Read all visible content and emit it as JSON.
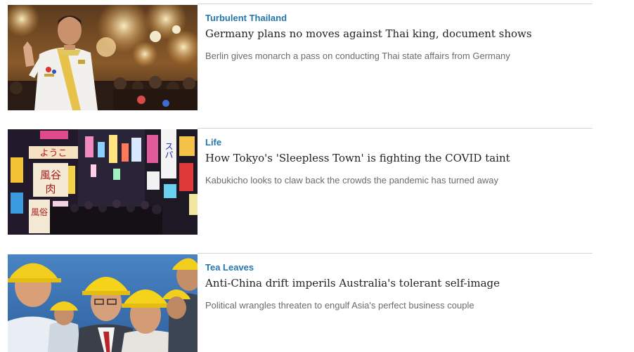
{
  "articles": [
    {
      "kicker": "Turbulent Thailand",
      "headline": "Germany plans no moves against Thai king, document shows",
      "summary": "Berlin gives monarch a pass on conducting Thai state affairs from Germany",
      "image": "photo-thai-king-waving"
    },
    {
      "kicker": "Life",
      "headline": "How Tokyo's 'Sleepless Town' is fighting the COVID taint",
      "summary": "Kabukicho looks to claw back the crowds the pandemic has turned away",
      "image": "photo-kabukicho-street-night",
      "sign_texts": [
        "ようこ",
        "風谷",
        "肉",
        "スパ",
        "風俗"
      ]
    },
    {
      "kicker": "Tea Leaves",
      "headline": "Anti-China drift imperils Australia's tolerant self-image",
      "summary": "Political wrangles threaten to engulf Asia's perfect business couple",
      "image": "photo-men-in-hard-hats"
    }
  ],
  "colors": {
    "kicker": "#2477ab",
    "headline": "#222222",
    "summary": "#6b6b6b",
    "divider": "#d4d4d4"
  }
}
